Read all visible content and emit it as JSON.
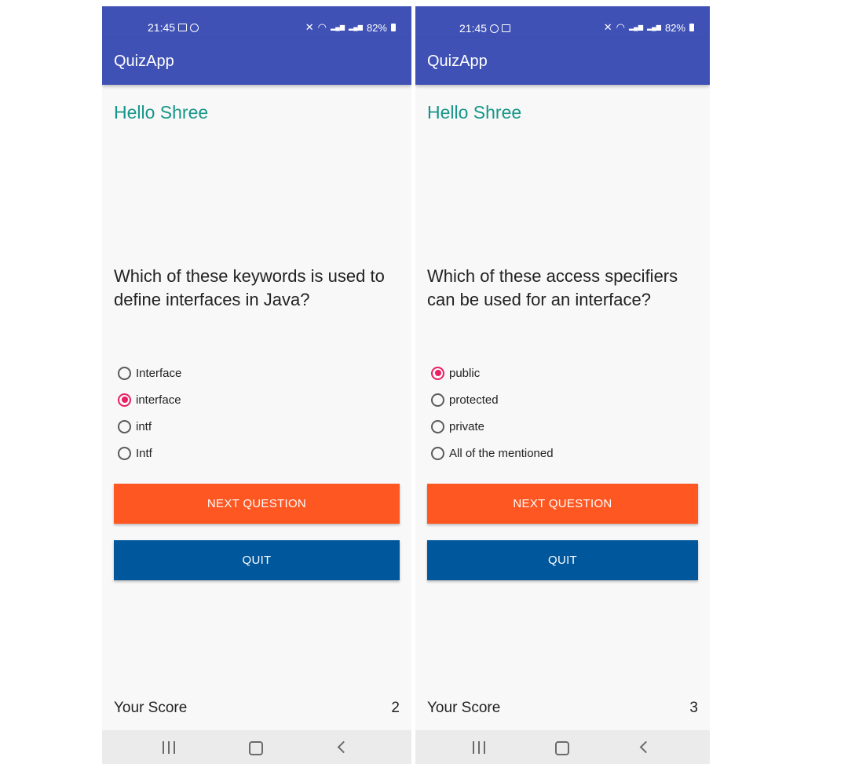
{
  "colors": {
    "primary": "#3f51b5",
    "accent": "#e91e63",
    "greeting": "#169688",
    "next_button": "#ff5722",
    "quit_button": "#01579b"
  },
  "screens": [
    {
      "status": {
        "time": "21:45",
        "battery": "82%"
      },
      "app_title": "QuizApp",
      "greeting": "Hello Shree",
      "question": "Which of these keywords is used to define interfaces in Java?",
      "options": [
        {
          "label": "Interface",
          "selected": false
        },
        {
          "label": "interface",
          "selected": true
        },
        {
          "label": "intf",
          "selected": false
        },
        {
          "label": "Intf",
          "selected": false
        }
      ],
      "next_label": "NEXT QUESTION",
      "quit_label": "QUIT",
      "score_label": "Your Score",
      "score_value": "2"
    },
    {
      "status": {
        "time": "21:45",
        "battery": "82%"
      },
      "app_title": "QuizApp",
      "greeting": "Hello Shree",
      "question": "Which of these access specifiers can be used for an interface?",
      "options": [
        {
          "label": "public",
          "selected": true
        },
        {
          "label": "protected",
          "selected": false
        },
        {
          "label": "private",
          "selected": false
        },
        {
          "label": "All of the mentioned",
          "selected": false
        }
      ],
      "next_label": "NEXT QUESTION",
      "quit_label": "QUIT",
      "score_label": "Your Score",
      "score_value": "3"
    }
  ]
}
